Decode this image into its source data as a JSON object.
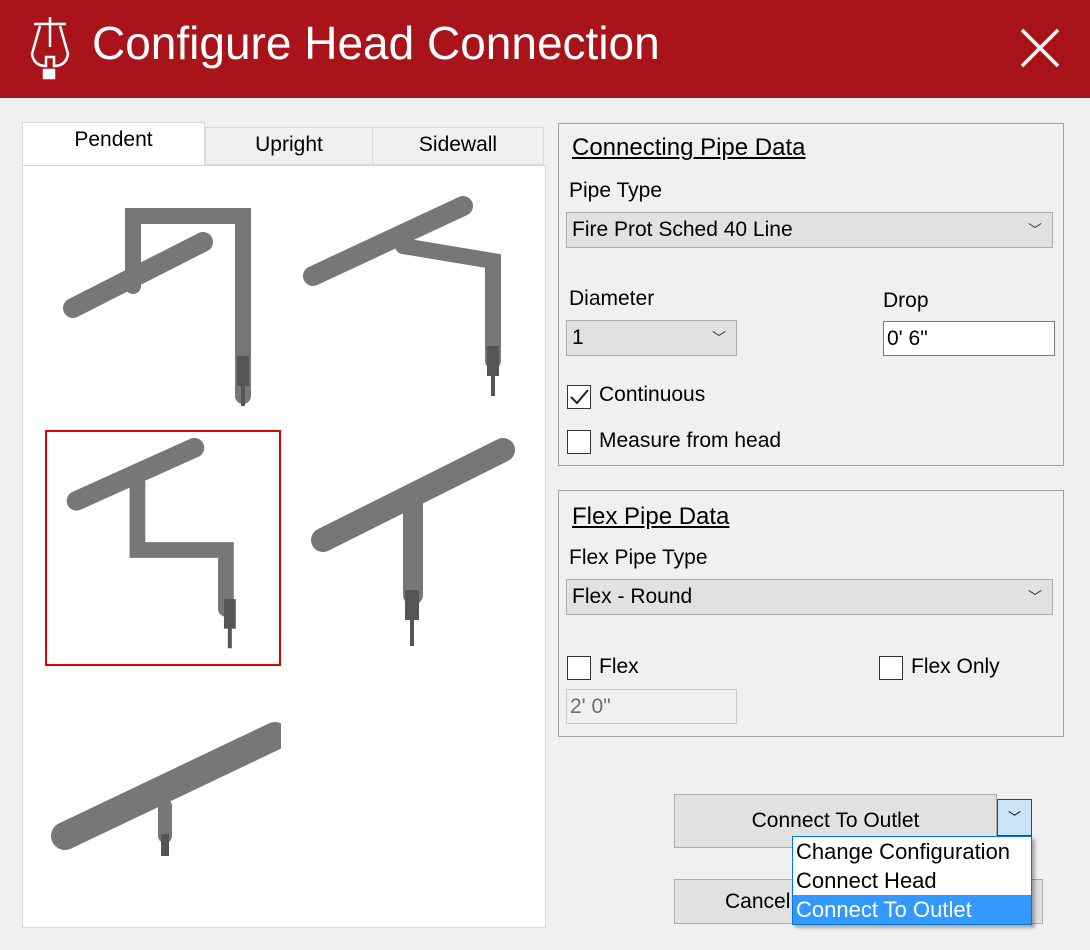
{
  "window": {
    "title": "Configure Head Connection",
    "logo": "TS sprinkler logo",
    "accent": "#a8141a"
  },
  "tabs": [
    {
      "label": "Pendent",
      "selected": true
    },
    {
      "label": "Upright",
      "selected": false
    },
    {
      "label": "Sidewall",
      "selected": false
    }
  ],
  "thumbnails": {
    "selected_index": 2,
    "count": 5
  },
  "connecting_pipe": {
    "title": "Connecting Pipe Data",
    "pipe_type_label": "Pipe Type",
    "pipe_type_value": "Fire Prot Sched 40 Line",
    "diameter_label": "Diameter",
    "diameter_value": "1",
    "drop_label": "Drop",
    "drop_value": "0'  6\"",
    "continuous_label": "Continuous",
    "continuous_checked": true,
    "measure_label": "Measure from head",
    "measure_checked": false
  },
  "flex_pipe": {
    "title": "Flex Pipe Data",
    "type_label": "Flex Pipe Type",
    "type_value": "Flex - Round",
    "flex_label": "Flex",
    "flex_checked": false,
    "flex_only_label": "Flex Only",
    "flex_only_checked": false,
    "length_value": "2'  0\""
  },
  "actions": {
    "connect_label": "Connect To Outlet",
    "cancel_label": "Cancel",
    "menu": [
      "Change Configuration",
      "Connect Head",
      "Connect To Outlet"
    ],
    "menu_highlight": 2,
    "highlight_color": "#3399ff"
  }
}
